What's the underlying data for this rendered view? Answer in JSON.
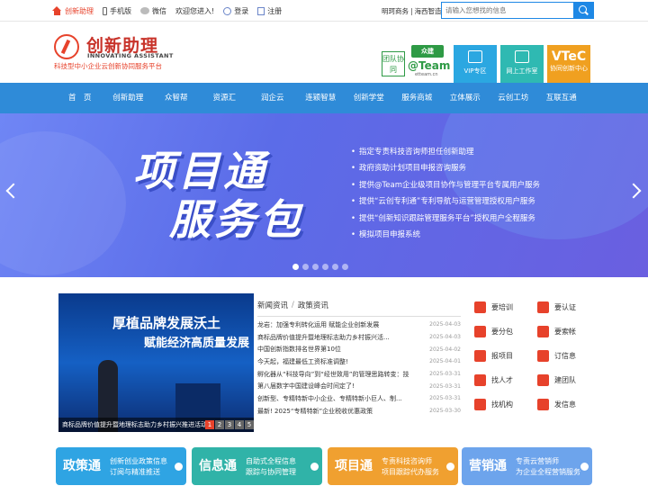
{
  "topbar": {
    "brand": "创新助理",
    "mobile": "手机版",
    "wechat": "微信",
    "welcome": "欢迎您进入!",
    "login": "登录",
    "register": "注册",
    "partner1": "明珂商务",
    "partner2": "海西智造",
    "search_placeholder": "请输入您想找的信息"
  },
  "header": {
    "logo_cn": "创新助理",
    "logo_en": "INNOVATING ASSISTANT",
    "logo_sub": "科技型中小企业云创新协同服务平台",
    "team_badge": "团队协同",
    "team_top": "众建",
    "team_main": "@Team",
    "team_sub": "etteam.cn",
    "vip_label": "VIP专区",
    "work_label": "网上工作室",
    "vtec_title": "VTeC",
    "vtec_label": "协同创新中心"
  },
  "nav": [
    "首　页",
    "创新助理",
    "众智帮",
    "资源汇",
    "润企云",
    "连颖智慧",
    "创新学堂",
    "服务商城",
    "立体展示",
    "云创工坊",
    "互联互通"
  ],
  "banner": {
    "title_line1": "项目通",
    "title_line2": "服务包",
    "items": [
      "指定专责科技咨询师担任创新助理",
      "政府资助计划项目申报咨询服务",
      "提供@Team企业级项目协作与管理平台专属用户服务",
      "提供“云创专利通”专利导航与运营管理授权用户服务",
      "提供“创新知识跟踪管理服务平台”授权用户全程服务",
      "模拟项目申报系统"
    ]
  },
  "news_image": {
    "screen_line1": "厚植品牌发展沃土",
    "screen_line2": "赋能经济高质量发展",
    "caption": "商标品牌价值提升暨地理标志助力乡村振兴推进活动",
    "pages": [
      "1",
      "2",
      "3",
      "4",
      "5"
    ]
  },
  "news": {
    "tab1": "新闻资讯",
    "tab2": "政策资讯",
    "rows": [
      {
        "title": "龙岩：加强专利转化运用 赋能企业创新发展",
        "date": "2025-04-03"
      },
      {
        "title": "商标品牌价值提升暨地理标志助力乡村振兴活...",
        "date": "2025-04-03"
      },
      {
        "title": "中国创新指数排名世界第10位",
        "date": "2025-04-02"
      },
      {
        "title": "今天起，福建最低工资标准调整!",
        "date": "2025-04-01"
      },
      {
        "title": "孵化器从“科技导向”到“经世致用”的管理思路转变：技",
        "date": "2025-03-31"
      },
      {
        "title": "第八届数字中国建设峰会时间定了!",
        "date": "2025-03-31"
      },
      {
        "title": "创新型、专精特新中小企业、专精特新小巨人、制...",
        "date": "2025-03-31"
      },
      {
        "title": "最新! 2025“专精特新”企业税收优惠政策",
        "date": "2025-03-30"
      }
    ]
  },
  "services": [
    "要培训",
    "要认证",
    "要分包",
    "要索帐",
    "报项目",
    "订信息",
    "找人才",
    "建团队",
    "找机构",
    "发信息"
  ],
  "cards": [
    {
      "key": "政策通",
      "line1": "创新创业政策信息",
      "line2": "订阅与精准推送"
    },
    {
      "key": "信息通",
      "line1": "自助式全程信息",
      "line2": "跟踪与协同管理"
    },
    {
      "key": "项目通",
      "line1": "专责科技咨询师",
      "line2": "项目跟踪代办服务"
    },
    {
      "key": "营销通",
      "line1": "专责云营销师",
      "line2": "为企业全程营销服务"
    }
  ]
}
